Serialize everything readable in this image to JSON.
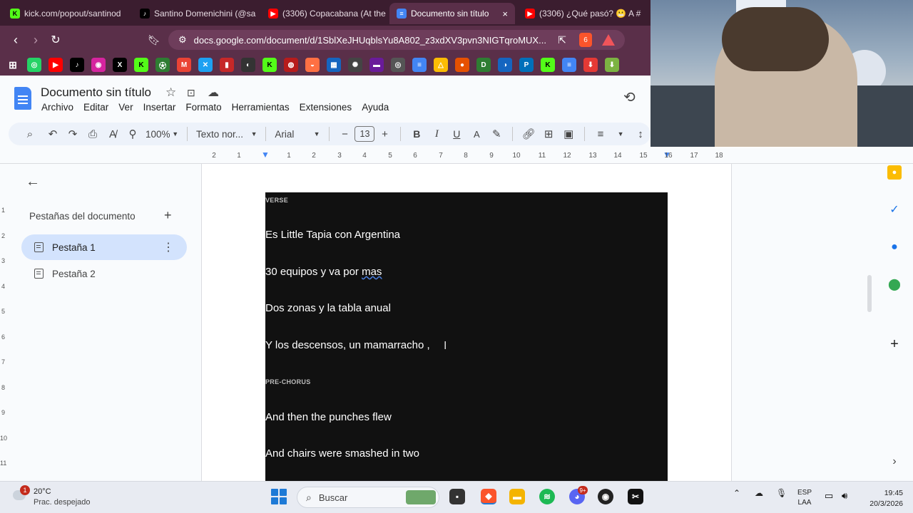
{
  "browser": {
    "tabs": [
      {
        "title": "kick.com/popout/santinod",
        "favicon": "kick-icon",
        "color": "#53fc18"
      },
      {
        "title": "Santino Domenichini (@sa",
        "favicon": "tiktok-icon",
        "color": "#000000"
      },
      {
        "title": "(3306) Copacabana (At the",
        "favicon": "youtube-icon",
        "color": "#ff0000"
      },
      {
        "title": "Documento sin título",
        "favicon": "docs-icon",
        "color": "#4285f4",
        "active": true
      },
      {
        "title": "(3306) ¿Qué pasó? 😬 A #",
        "favicon": "youtube-icon",
        "color": "#ff0000"
      }
    ],
    "close_glyph": "×",
    "url": "docs.google.com/document/d/1SblXeJHUqblsYu8A802_z3xdXV3pvn3NIGTqroMUX...",
    "brave_badge": "6"
  },
  "docs": {
    "title": "Documento sin título",
    "menu": [
      "Archivo",
      "Editar",
      "Ver",
      "Insertar",
      "Formato",
      "Herramientas",
      "Extensiones",
      "Ayuda"
    ],
    "toolbar": {
      "zoom": "100%",
      "style": "Texto nor...",
      "font": "Arial",
      "font_size": "13"
    },
    "ruler_ticks": [
      "2",
      "1",
      "1",
      "2",
      "3",
      "4",
      "5",
      "6",
      "7",
      "8",
      "9",
      "10",
      "11",
      "12",
      "13",
      "14",
      "15",
      "16",
      "17",
      "18"
    ],
    "vruler_ticks": [
      "1",
      "2",
      "3",
      "4",
      "5",
      "6",
      "7",
      "8",
      "9",
      "10",
      "11"
    ],
    "sidebar": {
      "title": "Pestañas del documento",
      "tabs": [
        {
          "label": "Pestaña 1",
          "active": true
        },
        {
          "label": "Pestaña 2",
          "active": false
        }
      ]
    },
    "content": {
      "verse_label": "VERSE",
      "verse_lines": [
        "Es Little Tapia con Argentina",
        "30 equipos y va por ",
        "Dos zonas y la tabla anual",
        "Y los descensos, un mamarracho ,"
      ],
      "verse_line2_squiggle": "mas",
      "prechorus_label": "PRE-CHORUS",
      "prechorus_lines": [
        "And then the punches flew",
        "And chairs were smashed in two"
      ]
    }
  },
  "taskbar": {
    "weather_temp": "20°C",
    "weather_desc": "Prac. despejado",
    "weather_badge": "1",
    "search_placeholder": "Buscar",
    "discord_badge": "9+",
    "lang_top": "ESP",
    "lang_bottom": "LAA",
    "time": "19:45",
    "date": "20/3/2026"
  }
}
